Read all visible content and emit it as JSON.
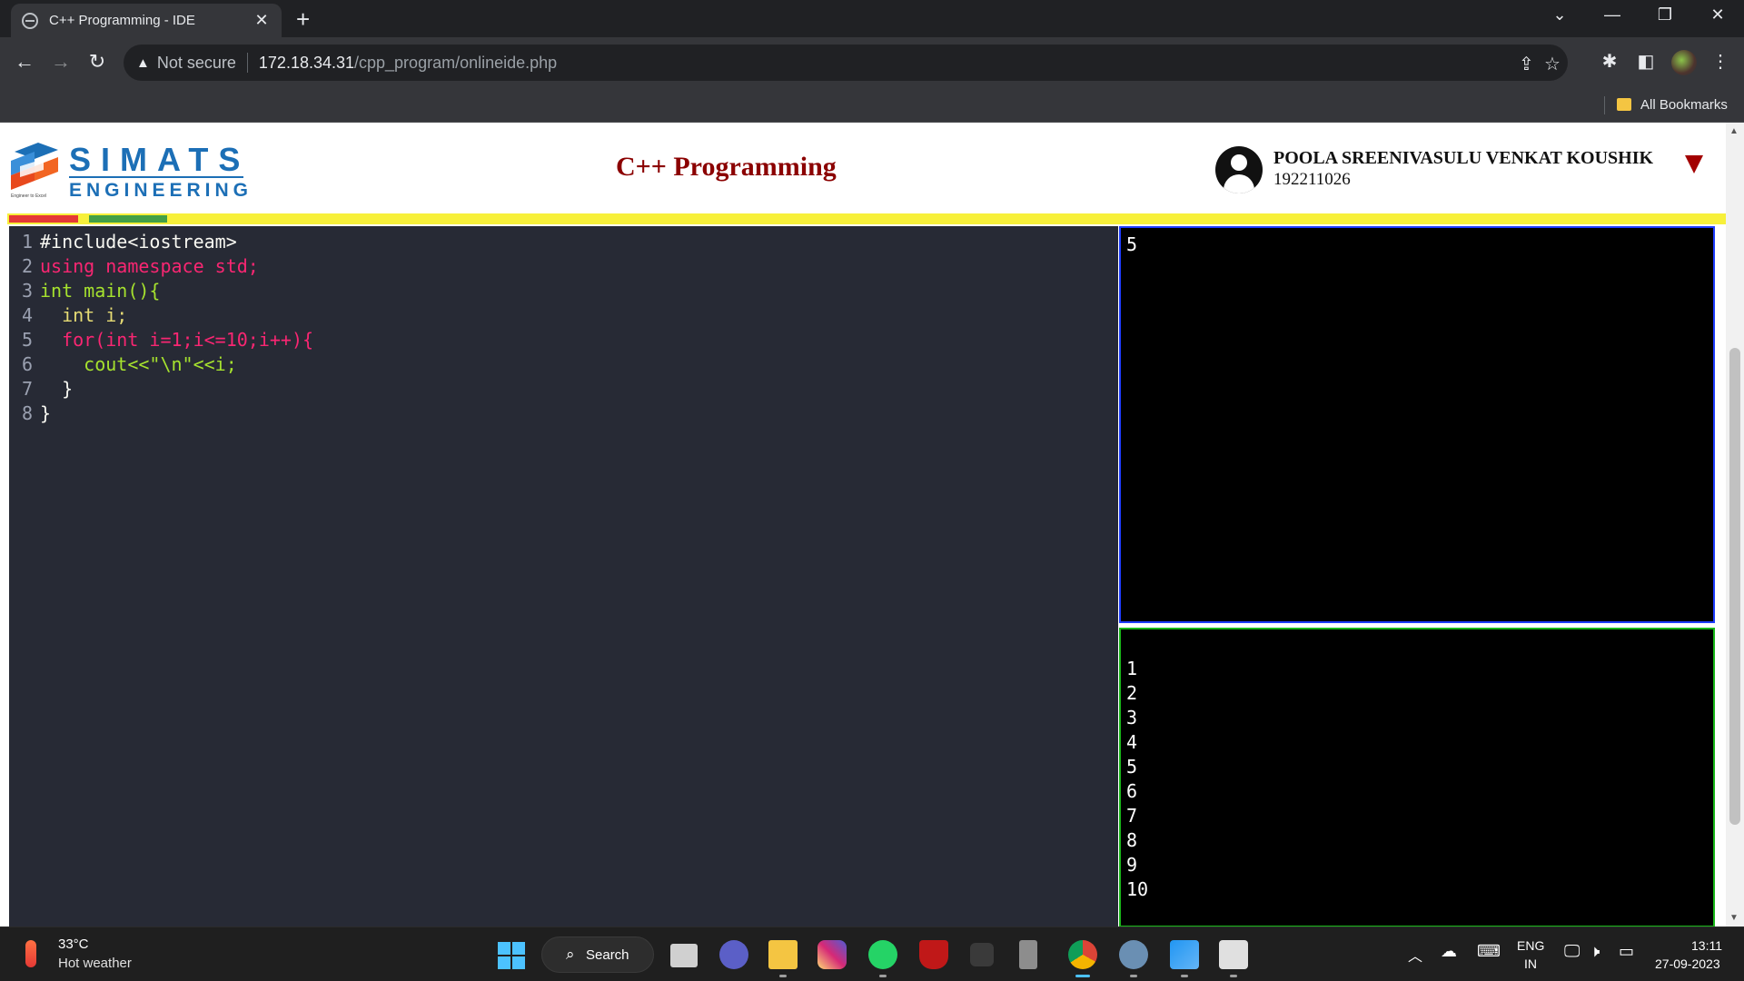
{
  "browser": {
    "tab_title": "C++ Programming - IDE",
    "tab_close": "✕",
    "new_tab": "+",
    "window_controls": {
      "dropdown": "⌄",
      "minimize": "—",
      "restore": "❐",
      "close": "✕"
    },
    "nav": {
      "back": "←",
      "forward": "→",
      "reload": "↻"
    },
    "address": {
      "warning_icon": "warning-triangle-icon",
      "security_label": "Not secure",
      "host": "172.18.34.31",
      "path": "/cpp_program/onlineide.php"
    },
    "toolbar_icons": [
      "share-icon",
      "star-icon",
      "extensions-icon",
      "side-panel-icon",
      "profile-avatar",
      "more-icon"
    ],
    "bookmarks_label": "All Bookmarks"
  },
  "header": {
    "logo_top": "SIMATS",
    "logo_bottom": "ENGINEERING",
    "logo_tagline": "Engineer to Excel",
    "title": "C++ Programming",
    "user_name": "POOLA SREENIVASULU VENKAT KOUSHIK",
    "user_id": "192211026"
  },
  "editor": {
    "lines": [
      {
        "num": "1",
        "text": "#include<iostream>"
      },
      {
        "num": "2",
        "text": "using namespace std;"
      },
      {
        "num": "3",
        "text": "int main(){"
      },
      {
        "num": "4",
        "text": "  int i;"
      },
      {
        "num": "5",
        "text": "  for(int i=1;i<=10;i++){"
      },
      {
        "num": "6",
        "text": "    cout<<\"\\n\"<<i;"
      },
      {
        "num": "7",
        "text": "  }"
      },
      {
        "num": "8",
        "text": "}"
      }
    ]
  },
  "input_panel": {
    "text": "5"
  },
  "output_panel": {
    "lines": [
      "1",
      "2",
      "3",
      "4",
      "5",
      "6",
      "7",
      "8",
      "9",
      "10"
    ]
  },
  "colors": {
    "title": "#8b0000",
    "editor_bg": "#272a35",
    "input_border": "#1e3cff",
    "output_border": "#19b719",
    "strip_yellow": "#f7f03a"
  },
  "taskbar": {
    "weather_temp": "33°C",
    "weather_desc": "Hot weather",
    "search_label": "Search",
    "apps": [
      "start-icon",
      "search-icon",
      "task-view-icon",
      "meet-icon",
      "file-explorer-icon",
      "instagram-icon",
      "whatsapp-icon",
      "mcafee-icon",
      "s-app-icon",
      "emblem-icon",
      "chrome-icon",
      "settings-icon",
      "photos-icon",
      "snipping-tool-icon"
    ],
    "tray": {
      "lang_top": "ENG",
      "lang_bottom": "IN",
      "time": "13:11",
      "date": "27-09-2023"
    }
  }
}
